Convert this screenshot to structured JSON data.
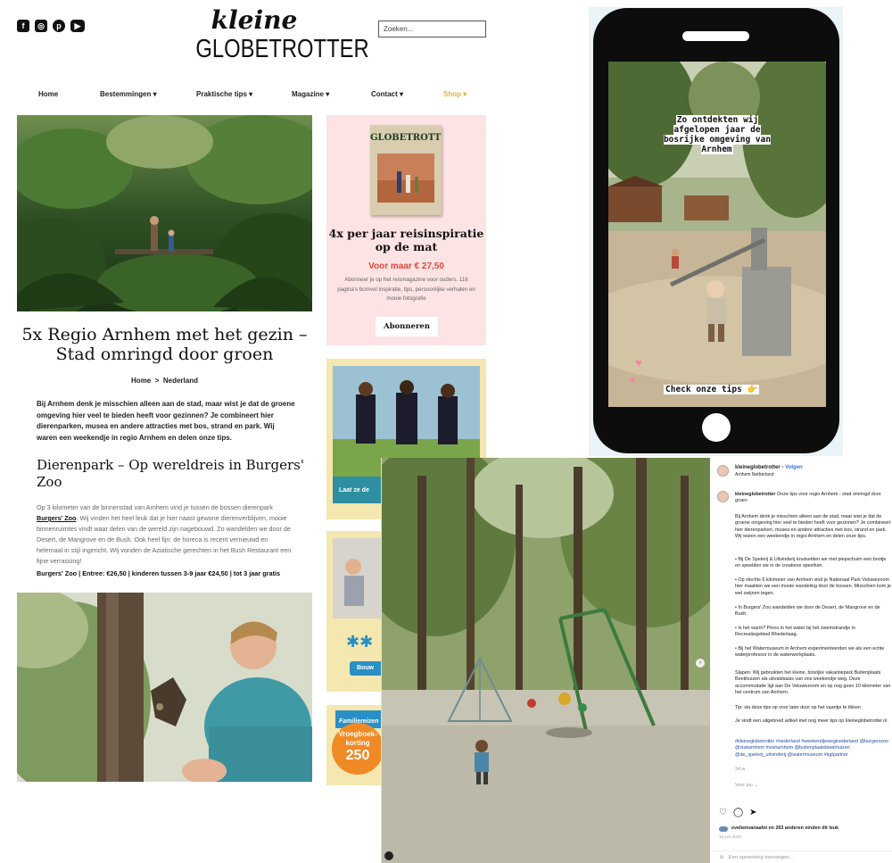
{
  "site": {
    "social_icons": [
      "facebook-icon",
      "instagram-icon",
      "pinterest-icon",
      "youtube-icon"
    ],
    "logo_top": "kleine",
    "logo_bottom": "GLOBETROTTER",
    "search_placeholder": "Zoeken...",
    "nav": {
      "home": "Home",
      "bestemmingen": "Bestemmingen ▾",
      "praktische": "Praktische tips ▾",
      "magazine": "Magazine ▾",
      "contact": "Contact ▾",
      "shop": "Shop ▾"
    },
    "article": {
      "title": "5x Regio Arnhem met het gezin – Stad omringd door groen",
      "breadcrumb_home": "Home",
      "breadcrumb_sep": ">",
      "breadcrumb_current": "Nederland",
      "intro": "Bij Arnhem denk je misschien alleen aan de stad, maar wist je dat de groene omgeving hier veel te bieden heeft voor gezinnen? Je combineert hier dierenparken, musea en andere attracties met bos, strand en park. Wij waren een weekendje in regio Arnhem en delen onze tips.",
      "h2": "Dierenpark – Op wereldreis in Burgers' Zoo",
      "body_a": "Op 3 kilometer van de binnenstad van Arnhem vind je tussen de bossen dierenpark",
      "body_link": "Burgers' Zoo",
      "body_b": ". Wij vinden het heel leuk dat je hier naast gewone dierenverblijven, mooie binnenruimtes vindt waar delen van de wereld zijn nagebouwd. Zo wandelden we door de Desert, de Mangrove en de Bush. Ook heel fijn: de horeca is recent vernieuwd en helemaal in stijl ingericht. Wij vonden de Aziatische gerechten in het Bush Restaurant een fijne verrassing!",
      "facts": "Burgers' Zoo | Entree: €26,50 | kinderen tussen 3-9 jaar €24,50 | tot 3 jaar gratis"
    },
    "promo": {
      "magazine_title": "GLOBETROTTER",
      "headline": "4x per jaar reisinspiratie op de mat",
      "price": "Voor maar € 27,50",
      "text": "Abonneer je op het reismagazine voor ouders. 116 pagina's bomvol inspiratie, tips, persoonlijke verhalen en mooie fotografie",
      "button": "Abonneren"
    },
    "ads": {
      "ad1_label": "Laat ze de",
      "ad2_label": "Bouw",
      "ad3_top": "Familiereizen",
      "ad3_burst_line1": "Vroegboek-",
      "ad3_burst_line2": "korting",
      "ad3_burst_value": "250"
    }
  },
  "phone": {
    "story_text": "Zo ontdekten wij afgelopen jaar de bosrijke omgeving van Arnhem",
    "cta": "Check onze tips 👉"
  },
  "instagram": {
    "username": "kleineglobetrotter",
    "follow_sep": "•",
    "follow": "Volgen",
    "location": "Arnhem Netherland",
    "caption_lead": "kleineglobetrotter",
    "caption_title": " Onze tips voor regio Arnhem - stad omringd door groen",
    "para1": "Bij Arnhem denk je misschien alleen aan de stad, maar wist je dat de groene omgeving hier veel te bieden heeft voor gezinnen? Je combineert hier dierenparken, musea en andere attracties met bos, strand en park. Wij waren een weekendje in regio Arnhem en delen onze tips.",
    "tip1": "• Bij De Spelerij & Uitvinderij knutselden we met piepschuim een bootje en speelden we in de creatieve speeltuin.",
    "tip2": "• Op slechts 6 kilometer van Arnhem vind je Nationaal Park Veluwezoom hier maakten we een mooie wandeling door de bossen. Misschien kom je wel zwijnen tegen.",
    "tip3": "• In Burgers' Zoo wandelden we door de Desert, de Mangrove en de Bush.",
    "tip4": "• Is het warm? Plons in het water bij het zwemstrandje in Recreatiegebied Rhederlaag.",
    "tip5": "• Bij het Watermuseum in Arnhem experimenteerden we als een echte waterprofessor in de waterwerkplaats.",
    "para2": "Slapen: Wij gebruikten het kleine, bosrijke vakantiepark Buitenplaats Beekhuizen als uitvalsbasis van ons weekendje weg. Deze accommodatie ligt aan De Veluwezoom en op nog geen 10 kilometer van het centrum van Arnhem.",
    "para3": "Tip: sla deze tips op voor later door op het vaantje te tikken",
    "para4": "Je vindt een uitgebreid artikel met nog meer tips op kleineglobetrotter.nl.",
    "hashtags": "#kleineglobetrotter #nederland #weekendjeweginederland @burgerszoo @visitarnhem #visitarnhem @buitenplaatsbeekhuizen @de_spelerij_uitvinderij @watermuseum #kgtpartner",
    "age": "34 w",
    "translate": "Voor jou ⌄",
    "likes": "evelienvanaafst en 263 anderen vinden dit leuk",
    "date": "12 juni 2022",
    "comment_placeholder": "Een opmerking toevoegen..."
  }
}
